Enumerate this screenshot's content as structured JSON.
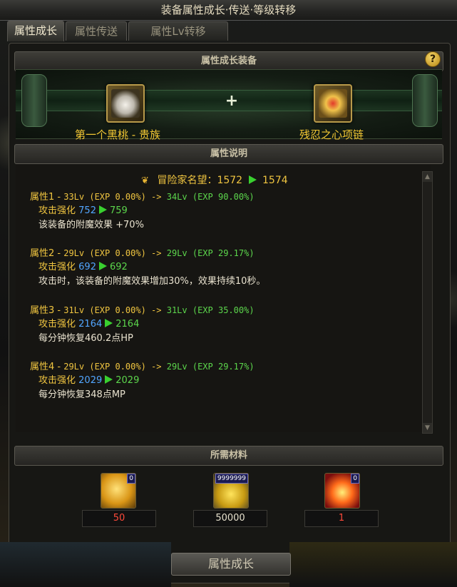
{
  "window": {
    "title": "装备属性成长·传送·等级转移"
  },
  "tabs": [
    {
      "label": "属性成长",
      "active": true
    },
    {
      "label": "属性传送",
      "active": false
    },
    {
      "label": "属性Lv转移",
      "active": false
    }
  ],
  "equip_section": {
    "header": "属性成长装备",
    "help": "?",
    "left_item": {
      "name": "第一个黑桃 - 贵族",
      "icon": "black-spade-ring-icon"
    },
    "plus": "+",
    "right_item": {
      "name": "残忍之心项链",
      "icon": "cruel-heart-necklace-icon"
    }
  },
  "desc_section": {
    "header": "属性说明",
    "fame": {
      "label": "冒险家名望",
      "sep": "：",
      "from": "1572",
      "to": "1574"
    },
    "attributes": [
      {
        "title": "属性1 - ",
        "exp_from": "33Lv (EXP 0.00%) -> ",
        "exp_to": "34Lv (EXP 90.00%)",
        "stat_label": "攻击强化",
        "stat_from": "752",
        "stat_to": "759",
        "effect": "该装备的附魔效果 +70%"
      },
      {
        "title": "属性2 - ",
        "exp_from": "29Lv (EXP 0.00%) -> ",
        "exp_to": "29Lv (EXP 29.17%)",
        "stat_label": "攻击强化",
        "stat_from": "692",
        "stat_to": "692",
        "effect": "攻击时，该装备的附魔效果增加30%，效果持续10秒。"
      },
      {
        "title": "属性3 - ",
        "exp_from": "31Lv (EXP 0.00%) -> ",
        "exp_to": "31Lv (EXP 35.00%)",
        "stat_label": "攻击强化",
        "stat_from": "2164",
        "stat_to": "2164",
        "effect": "每分钟恢复460.2点HP"
      },
      {
        "title": "属性4 - ",
        "exp_from": "29Lv (EXP 0.00%) -> ",
        "exp_to": "29Lv (EXP 29.17%)",
        "stat_label": "攻击强化",
        "stat_from": "2029",
        "stat_to": "2029",
        "effect": "每分钟恢复348点MP"
      }
    ]
  },
  "materials_section": {
    "header": "所需材料",
    "items": [
      {
        "icon": "gold-crystal-icon",
        "badge": "0",
        "count": "50",
        "count_color": "#ff4a3a"
      },
      {
        "icon": "gold-coins-icon",
        "badge": "9999999",
        "count": "50000",
        "count_color": "#e6e0cc"
      },
      {
        "icon": "fire-orb-icon",
        "badge": "0",
        "count": "1",
        "count_color": "#ff4a3a"
      }
    ]
  },
  "action": {
    "label": "属性成长"
  },
  "colors": {
    "gold": "#f0c540",
    "green": "#5cd64c",
    "blue": "#52a6ff",
    "red": "#ff4a3a"
  }
}
